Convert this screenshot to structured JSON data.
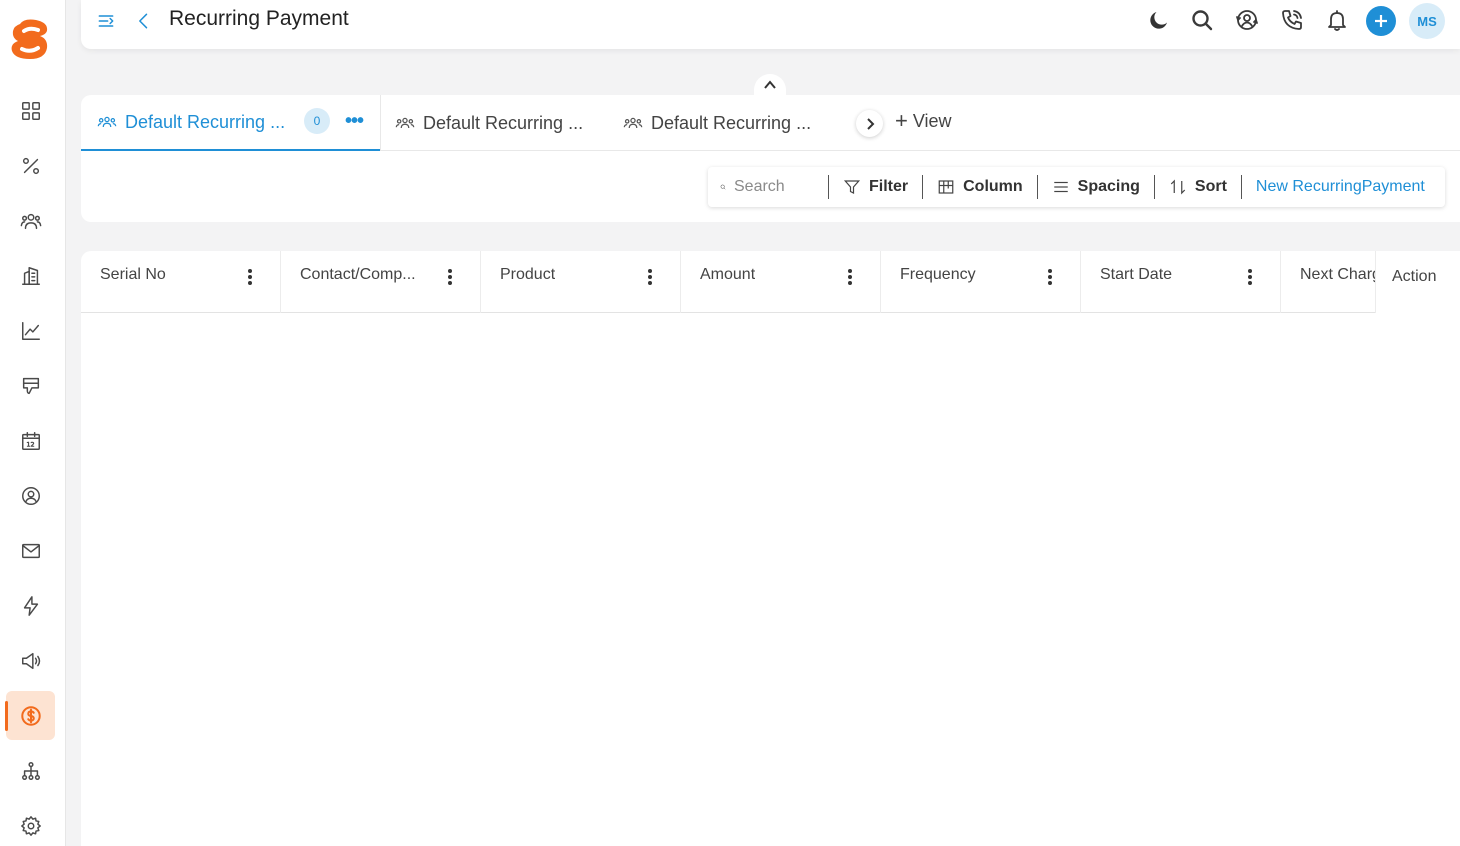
{
  "header": {
    "title": "Recurring Payment",
    "avatar_initials": "MS"
  },
  "tabs": [
    {
      "label": "Default Recurring ...",
      "badge": "0",
      "more": "•••"
    },
    {
      "label": "Default Recurring ..."
    },
    {
      "label": "Default Recurring ..."
    }
  ],
  "add_view_label": "View",
  "add_view_plus": "+",
  "toolbar": {
    "search_placeholder": "Search",
    "filter_label": "Filter",
    "column_label": "Column",
    "spacing_label": "Spacing",
    "sort_label": "Sort",
    "new_label": "New RecurringPayment"
  },
  "table": {
    "columns": [
      "Serial No",
      "Contact/Comp...",
      "Product",
      "Amount",
      "Frequency",
      "Start Date",
      "Next Charge"
    ],
    "action_label": "Action"
  },
  "colors": {
    "accent": "#1f8fd6",
    "brand": "#f26b1d"
  },
  "sidebar_icons": [
    "dashboard-icon",
    "percent-icon",
    "contacts-icon",
    "company-icon",
    "chart-icon",
    "thumbs-down-icon",
    "calendar-icon",
    "user-circle-icon",
    "mail-icon",
    "lightning-icon",
    "megaphone-icon",
    "dollar-icon",
    "hierarchy-icon",
    "settings-icon"
  ]
}
